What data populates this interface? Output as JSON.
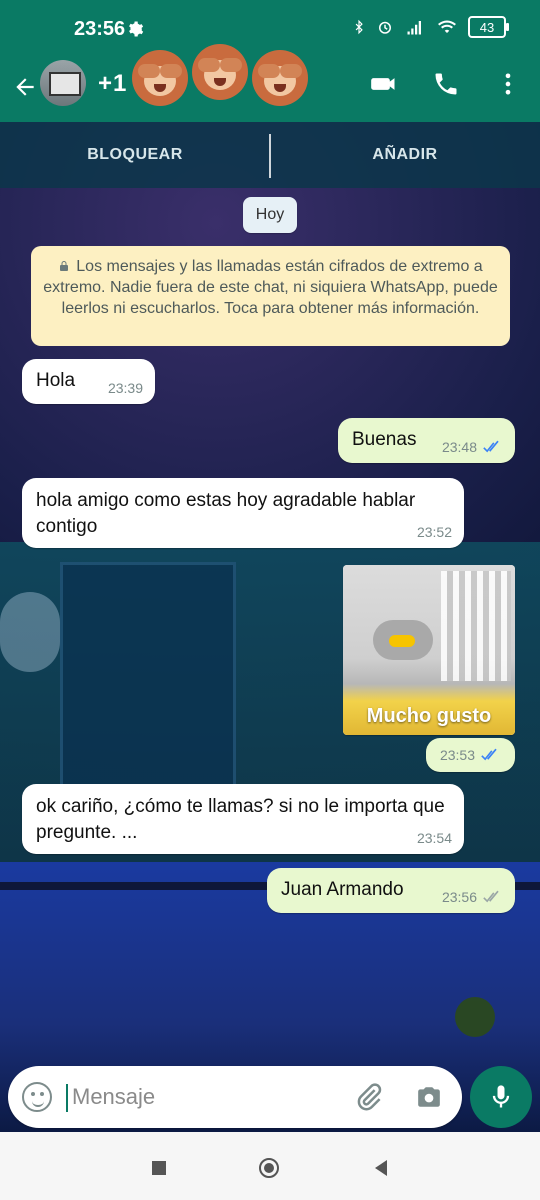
{
  "status_bar": {
    "time": "23:56",
    "battery": "43"
  },
  "header": {
    "title": "+1"
  },
  "banner": {
    "block": "BLOQUEAR",
    "add": "AÑADIR"
  },
  "chat": {
    "date_chip": "Hoy",
    "notice": "Los mensajes y las llamadas están cifrados de extremo a extremo. Nadie fuera de este chat, ni siquiera WhatsApp, puede leerlos ni escucharlos. Toca para obtener más información.",
    "messages": [
      {
        "text": "Hola",
        "time": "23:39"
      },
      {
        "text": "Buenas",
        "time": "23:48"
      },
      {
        "text": "hola amigo como estas hoy agradable hablar contigo",
        "time": "23:52"
      },
      {
        "caption": "Mucho gusto",
        "time": "23:53"
      },
      {
        "text": "ok cariño, ¿cómo te llamas? si no le importa que pregunte. ...",
        "time": "23:54"
      },
      {
        "text": "Juan Armando",
        "time": "23:56"
      }
    ]
  },
  "composer": {
    "placeholder": "Mensaje"
  },
  "colors": {
    "primary": "#0a7a64",
    "outgoing": "#e8f8cf",
    "notice": "#fdf0c2",
    "tick_read": "#3b82f6"
  }
}
